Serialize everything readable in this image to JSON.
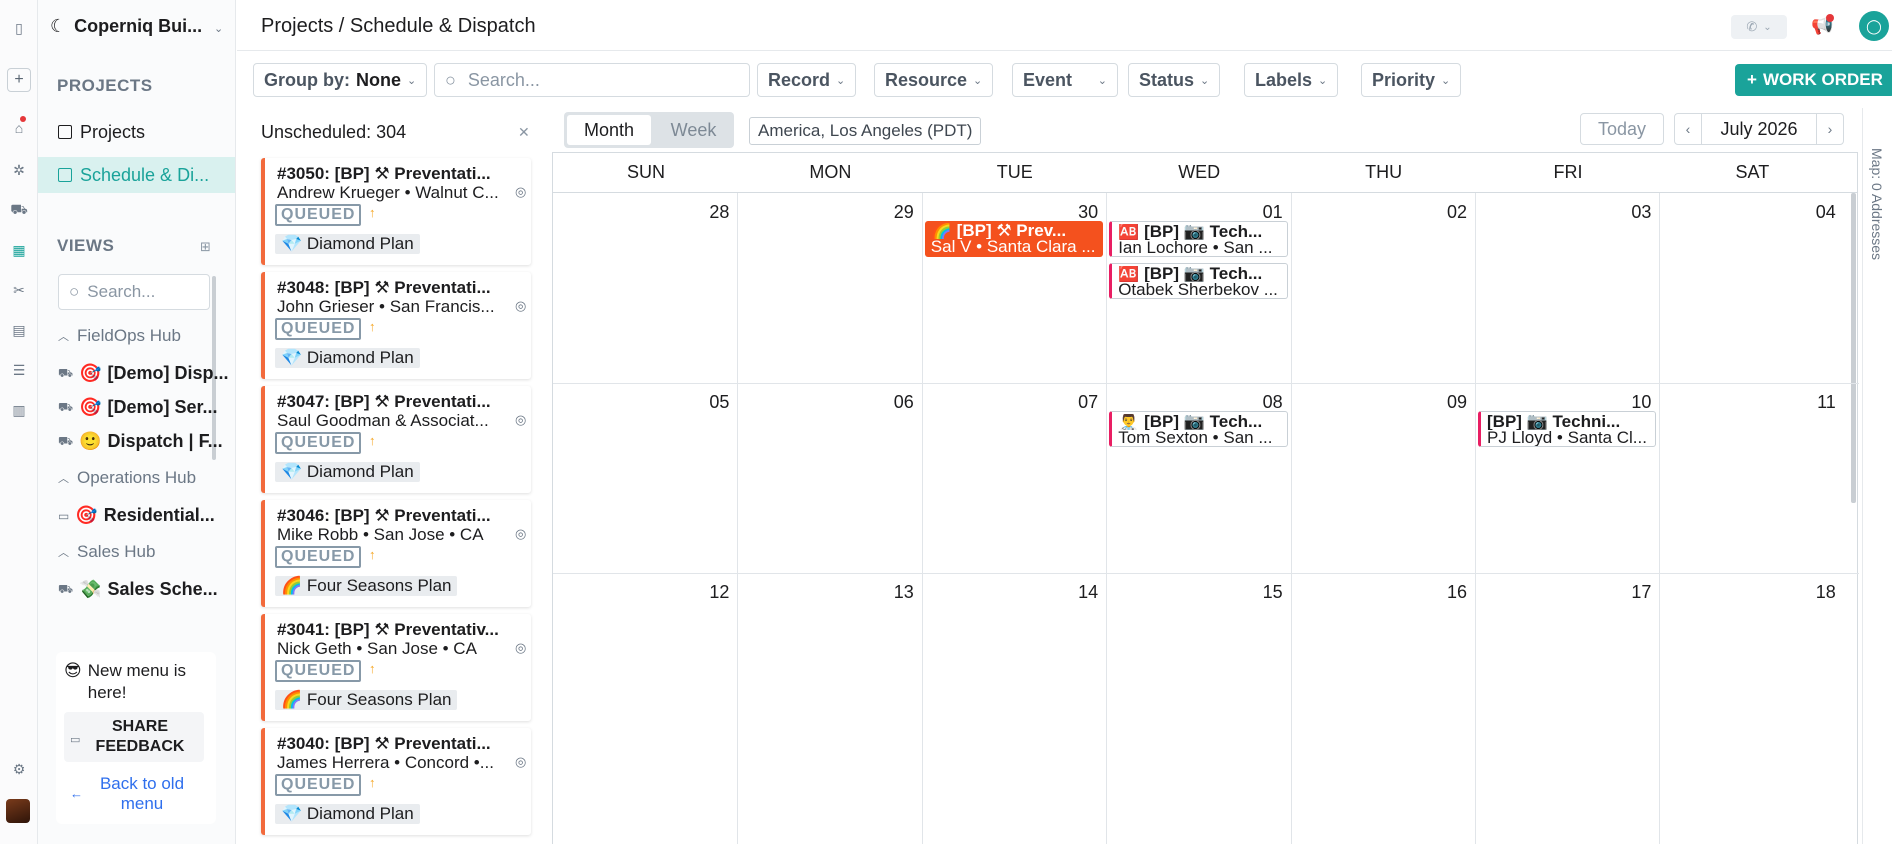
{
  "header": {
    "breadcrumb": "Projects / Schedule & Dispatch"
  },
  "workspace": {
    "name": "Coperniq Bui..."
  },
  "sidebar": {
    "projects_title": "PROJECTS",
    "projects_items": [
      {
        "label": "Projects"
      },
      {
        "label": "Schedule & Di..."
      }
    ],
    "views_title": "VIEWS",
    "search_placeholder": "Search...",
    "hubs": [
      {
        "label": "FieldOps Hub"
      },
      {
        "label": "Operations Hub"
      },
      {
        "label": "Sales Hub"
      }
    ],
    "views": [
      {
        "label": "[Demo] Disp...",
        "emoji": "🎯"
      },
      {
        "label": "[Demo] Ser...",
        "emoji": "🎯"
      },
      {
        "label": "Dispatch | F...",
        "emoji": "🙂"
      },
      {
        "label": "Residential...",
        "emoji": "🎯"
      },
      {
        "label": "Sales Sche...",
        "emoji": "💸"
      }
    ],
    "promo_text": "New menu is here!",
    "promo_emoji": "😎",
    "feedback_label": "SHARE FEEDBACK",
    "back_label": "Back to old menu"
  },
  "toolbar": {
    "group_by_label": "Group by:",
    "group_by_value": "None",
    "search_placeholder": "Search...",
    "filters": [
      "Record",
      "Resource",
      "Event",
      "Status",
      "Labels",
      "Priority"
    ],
    "work_order_label": "WORK ORDER"
  },
  "unscheduled": {
    "title": "Unscheduled: 304",
    "cards": [
      {
        "title": "#3050: [BP] ⚒ Preventati...",
        "sub": "Andrew Krueger • Walnut C...",
        "status": "QUEUED",
        "plan": "💎 Diamond Plan"
      },
      {
        "title": "#3048: [BP] ⚒ Preventati...",
        "sub": "John Grieser • San Francis...",
        "status": "QUEUED",
        "plan": "💎 Diamond Plan"
      },
      {
        "title": "#3047: [BP] ⚒ Preventati...",
        "sub": "Saul Goodman & Associat...",
        "status": "QUEUED",
        "plan": "💎 Diamond Plan"
      },
      {
        "title": "#3046: [BP] ⚒ Preventati...",
        "sub": "Mike Robb • San Jose • CA",
        "status": "QUEUED",
        "plan": "🌈 Four Seasons Plan"
      },
      {
        "title": "#3041: [BP] ⚒ Preventativ...",
        "sub": "Nick Geth • San Jose • CA",
        "status": "QUEUED",
        "plan": "🌈 Four Seasons Plan"
      },
      {
        "title": "#3040: [BP] ⚒ Preventati...",
        "sub": "James Herrera • Concord •...",
        "status": "QUEUED",
        "plan": "💎 Diamond Plan"
      }
    ]
  },
  "calendar": {
    "view_month": "Month",
    "view_week": "Week",
    "timezone": "America, Los Angeles (PDT)",
    "today_label": "Today",
    "month_label": "July 2026",
    "weekdays": [
      "SUN",
      "MON",
      "TUE",
      "WED",
      "THU",
      "FRI",
      "SAT"
    ],
    "weeks": [
      [
        "28",
        "29",
        "30",
        "01",
        "02",
        "03",
        "04"
      ],
      [
        "05",
        "06",
        "07",
        "08",
        "09",
        "10",
        "11"
      ],
      [
        "12",
        "13",
        "14",
        "15",
        "16",
        "17",
        "18"
      ]
    ],
    "events": [
      {
        "title": "🌈 [BP] ⚒ Prev...",
        "sub": "Sal V • Santa Clara ..."
      },
      {
        "title": "🆎 [BP] 📷 Tech...",
        "sub": "Ian Lochore • San ..."
      },
      {
        "title": "🆎 [BP] 📷 Tech...",
        "sub": "Otabek Sherbekov ..."
      },
      {
        "title": "👨‍⚕️ [BP] 📷 Tech...",
        "sub": "Tom Sexton • San ..."
      },
      {
        "title": "[BP] 📷 Techni...",
        "sub": "PJ Lloyd • Santa Cl..."
      }
    ]
  },
  "right_panel": {
    "label": "Map: 0 Addresses"
  }
}
